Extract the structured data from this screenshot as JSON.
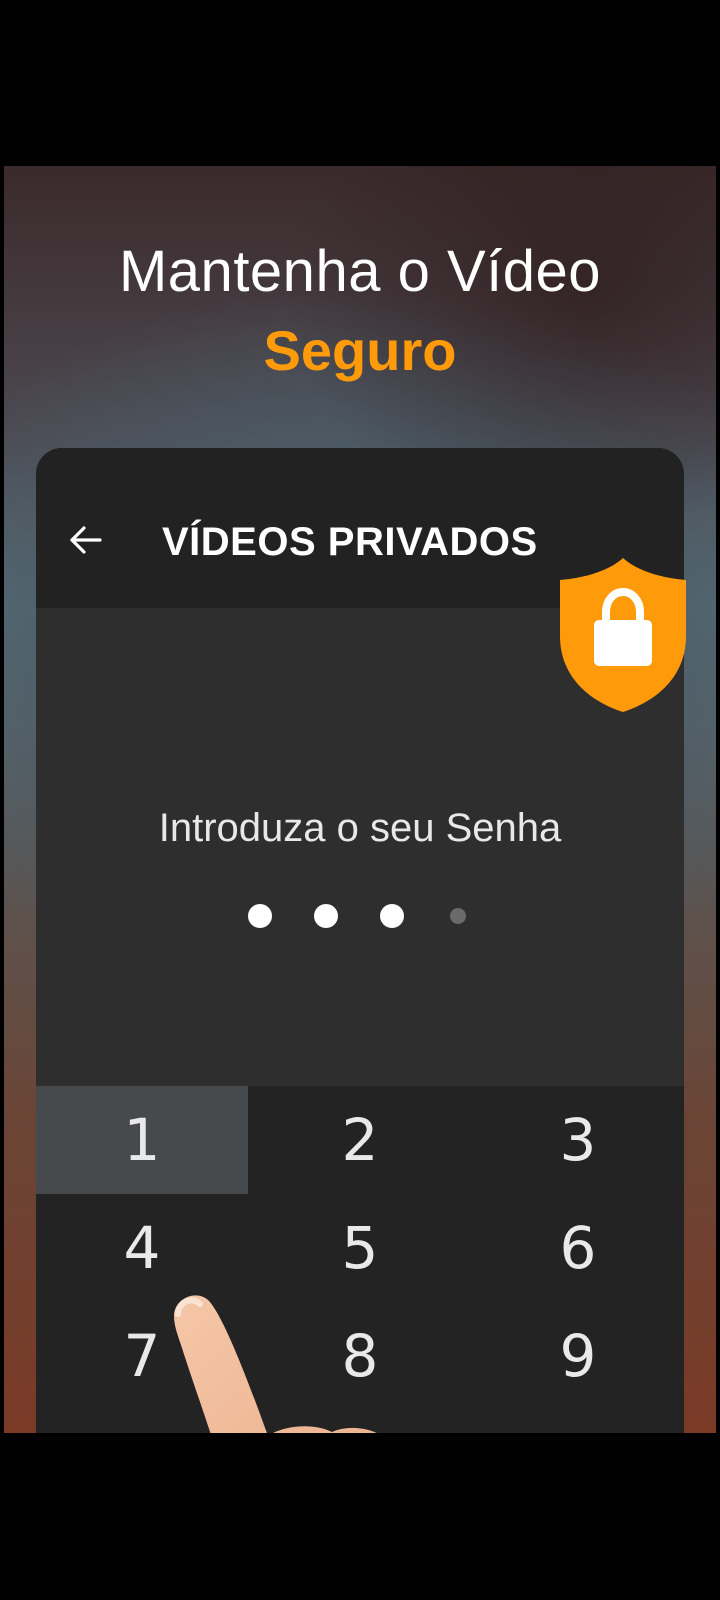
{
  "promo": {
    "headline": "Mantenha o Vídeo",
    "highlight": "Seguro"
  },
  "colors": {
    "accent": "#ff9b0a",
    "panel": "#2e2e2e",
    "appbar": "#222222"
  },
  "appbar": {
    "back_icon": "back-arrow-icon",
    "title": "VÍDEOS PRIVADOS"
  },
  "badge_icon": "shield-lock-icon",
  "lock": {
    "prompt": "Introduza o seu Senha",
    "pin_length": 4,
    "pin_entered": 3
  },
  "keypad": {
    "keys": [
      "1",
      "2",
      "3",
      "4",
      "5",
      "6",
      "7",
      "8",
      "9"
    ],
    "pressed_key": "1"
  }
}
